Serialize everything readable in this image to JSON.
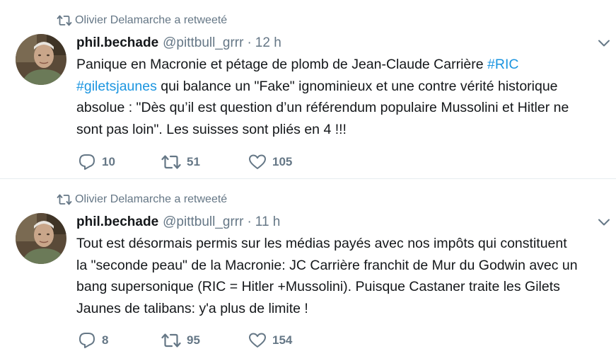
{
  "tweets": [
    {
      "retweet_context": "Olivier Delamarche a retweeté",
      "author_name": "phil.bechade",
      "author_handle": "@pittbull_grrr",
      "separator": "·",
      "time": "12 h",
      "text_lines": [
        [
          {
            "text": "Panique en Macronie et pétage de plomb de Jean-Claude Carrière ",
            "link": false
          },
          {
            "text": "#RIC",
            "link": true
          }
        ],
        [
          {
            "text": "#giletsjaunes",
            "link": true
          },
          {
            "text": " qui balance un \"Fake\" ignominieux et une contre vérité historique",
            "link": false
          }
        ],
        [
          {
            "text": "absolue : \"Dès qu’il est question d’un référendum populaire Mussolini et Hitler ne",
            "link": false
          }
        ],
        [
          {
            "text": "sont pas loin\". Les suisses sont pliés en 4 !!!",
            "link": false
          }
        ]
      ],
      "replies": "10",
      "retweets": "51",
      "likes": "105"
    },
    {
      "retweet_context": "Olivier Delamarche a retweeté",
      "author_name": "phil.bechade",
      "author_handle": "@pittbull_grrr",
      "separator": "·",
      "time": "11 h",
      "text_lines": [
        [
          {
            "text": "Tout est désormais permis sur les médias payés avec nos impôts qui constituent",
            "link": false
          }
        ],
        [
          {
            "text": "la \"seconde peau\" de la Macronie:  JC Carrière franchit de Mur du Godwin avec un",
            "link": false
          }
        ],
        [
          {
            "text": "bang supersonique (RIC = Hitler +Mussolini). Puisque Castaner traite les Gilets",
            "link": false
          }
        ],
        [
          {
            "text": "Jaunes de talibans: y'a plus de limite !",
            "link": false
          }
        ]
      ],
      "replies": "8",
      "retweets": "95",
      "likes": "154"
    }
  ],
  "colors": {
    "text": "#14171a",
    "muted": "#657786",
    "link": "#1b95e0",
    "divider": "#e6ecf0"
  },
  "icons": {
    "retweet_context": "retweet-icon",
    "caret": "chevron-down-icon",
    "reply": "reply-icon",
    "retweet": "retweet-icon",
    "like": "heart-icon"
  }
}
